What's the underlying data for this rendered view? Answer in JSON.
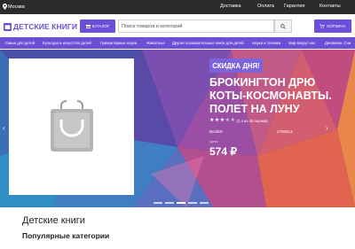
{
  "topbar": {
    "location": "Москва",
    "links": [
      "Доставка",
      "Оплата",
      "Гарантия",
      "Контакты"
    ]
  },
  "header": {
    "logo_text": "ДЕТСКИЕ КНИГИ",
    "catalog_label": "КАТАЛОГ",
    "search_placeholder": "Поиск товаров и категорий",
    "cart_label": "КОРЗИНА"
  },
  "nav": {
    "items": [
      "Смыж для детей",
      "Культура и искусство детей",
      "Гуманитарные науки",
      "Животные",
      "Другие познавательные книги для детей",
      "Наука и техника",
      "Мир вокруг нас",
      "Дневники. Сни"
    ]
  },
  "banner": {
    "badge": "СКИДКА ДНЯ!",
    "title": "БРОКИНГТОН ДРЮ КОТЫ-КОСМОНАВТЫ. ПОЛЕТ НА ЛУНУ",
    "rating_text": "(2.4 из 49 оценки)",
    "rating": 3,
    "rating_max": 5,
    "bookid_label": "BookID",
    "bookid_value": "2760913",
    "price_label": "Цена",
    "price": "574 ₽",
    "slide_count": 5,
    "active_slide": 2,
    "colors": {
      "accent": "#6c4fd6",
      "badge": "#7b63dc"
    }
  },
  "main": {
    "title": "Детские книги",
    "subtitle": "Популярные категории"
  },
  "icons": {
    "location": "map-pin-icon",
    "logo": "book-icon",
    "catalog": "menu-icon",
    "search": "search-icon",
    "cart": "cart-icon",
    "placeholder": "shopping-bag-icon"
  }
}
